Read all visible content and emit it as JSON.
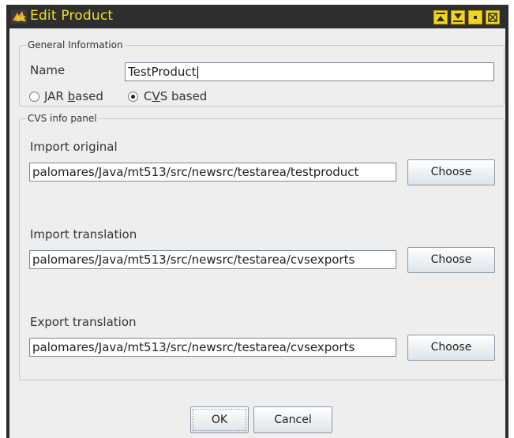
{
  "window": {
    "title": "Edit Product"
  },
  "general": {
    "legend": "General Information",
    "name_label": "Name",
    "name_value": "TestProduct",
    "radio_jar_label_pre": "JAR ",
    "radio_jar_label_u": "b",
    "radio_jar_label_post": "ased",
    "radio_cvs_label_pre": "C",
    "radio_cvs_label_u": "V",
    "radio_cvs_label_post": "S based",
    "selected": "CVS based"
  },
  "cvs": {
    "legend": "CVS info panel",
    "import_original_label": "Import original",
    "import_original_path": "palomares/Java/mt513/src/newsrc/testarea/testproduct",
    "import_translation_label": "Import translation",
    "import_translation_path": "palomares/Java/mt513/src/newsrc/testarea/cvsexports",
    "export_translation_label": "Export translation",
    "export_translation_path": "palomares/Java/mt513/src/newsrc/testarea/cvsexports",
    "choose_label": "Choose"
  },
  "footer": {
    "ok_label": "OK",
    "cancel_label": "Cancel"
  },
  "colors": {
    "title_text": "#f2e01a",
    "titlebar_bg": "#2e2e2e",
    "dialog_bg": "#eeeeee",
    "frame": "#2b2b2b"
  },
  "icons": [
    "app-icon",
    "minimize-icon",
    "maximize-icon",
    "restore-icon",
    "close-icon"
  ]
}
